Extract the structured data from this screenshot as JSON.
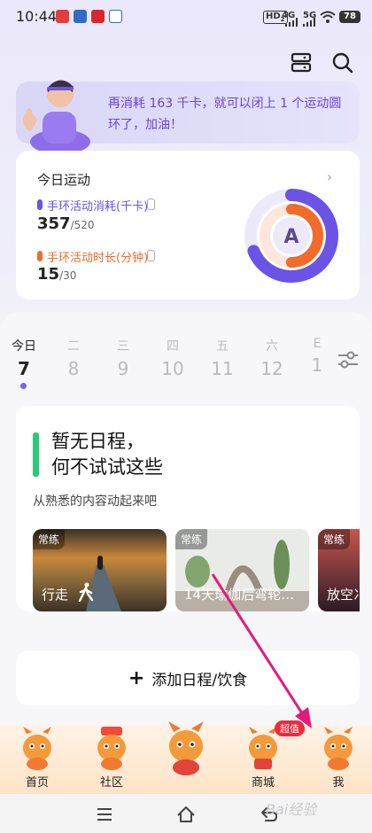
{
  "status_bar": {
    "time": "10:44",
    "hd_label": "HD",
    "hd_sub": "2",
    "net1": "4G",
    "net2": "5G",
    "battery": "78"
  },
  "header": {
    "icons": [
      "calendar-stack-icon",
      "search-icon"
    ]
  },
  "banner": {
    "message": "再消耗 163 千卡，就可以闭上 1 个运动圆环了，加油！"
  },
  "activity": {
    "title": "今日运动",
    "calories": {
      "label": "手环活动消耗(千卡)",
      "value": "357",
      "target": "/520",
      "progress": 0.687,
      "color": "#6b53e6"
    },
    "duration": {
      "label": "手环活动时长(分钟)",
      "value": "15",
      "target": "/30",
      "progress": 0.5,
      "color": "#f26b2b"
    },
    "ring_letter": "A"
  },
  "week": [
    {
      "name": "今日",
      "num": "7",
      "active": true
    },
    {
      "name": "二",
      "num": "8"
    },
    {
      "name": "三",
      "num": "9"
    },
    {
      "name": "四",
      "num": "10"
    },
    {
      "name": "五",
      "num": "11"
    },
    {
      "name": "六",
      "num": "12"
    },
    {
      "name": "E",
      "num": "1"
    }
  ],
  "schedule": {
    "title_line1": "暂无日程，",
    "title_line2": "何不试试这些",
    "subtitle": "从熟悉的内容动起来吧",
    "tiles": [
      {
        "tag": "常练",
        "label": "行走"
      },
      {
        "tag": "常练",
        "label": "14天瑜伽后弯轮…"
      },
      {
        "tag": "常练",
        "label": "放空冫"
      }
    ]
  },
  "add_button": {
    "label": "添加日程/饮食"
  },
  "tabs": [
    {
      "label": "首页"
    },
    {
      "label": "社区"
    },
    {
      "label": ""
    },
    {
      "label": "商城",
      "badge": "超值"
    },
    {
      "label": "我"
    }
  ],
  "watermark": "Bai经验"
}
